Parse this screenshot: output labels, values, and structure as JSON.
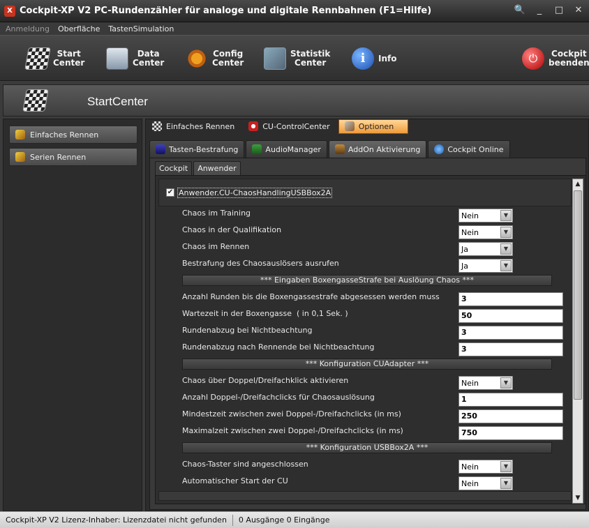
{
  "window": {
    "title": "Cockpit-XP V2 PC-Rundenzähler für analoge und digitale Rennbahnen (F1=Hilfe)",
    "app_icon_text": "X",
    "buttons": {
      "search": "🔍",
      "minimize": "_",
      "maximize": "□",
      "close": "✕"
    }
  },
  "menu": [
    "Anmeldung",
    "Oberfläche",
    "TastenSimulation"
  ],
  "toolbar": {
    "start": "Start\nCenter",
    "data": "Data\nCenter",
    "config": "Config\nCenter",
    "statistik": "Statistik\nCenter",
    "info": "Info",
    "beenden": "Cockpit\nbeenden"
  },
  "header": {
    "title": "StartCenter"
  },
  "left": {
    "items": [
      "Einfaches Rennen",
      "Serien Rennen"
    ]
  },
  "tabs1": [
    "Einfaches Rennen",
    "CU-ControlCenter",
    "Optionen"
  ],
  "tabs2": [
    "Tasten-Bestrafung",
    "AudioManager",
    "AddOn Aktivierung",
    "Cockpit Online"
  ],
  "tabs3": [
    "Cockpit",
    "Anwender"
  ],
  "addon": {
    "checked": true,
    "label": "Anwender.CU-ChaosHandlingUSBBox2A"
  },
  "settings": {
    "chaos_training": {
      "label": "Chaos im Training",
      "value": "Nein"
    },
    "chaos_quali": {
      "label": "Chaos in der Qualifikation",
      "value": "Nein"
    },
    "chaos_rennen": {
      "label": "Chaos im Rennen",
      "value": "Ja"
    },
    "bestrafung": {
      "label": "Bestrafung des Chaosauslösers ausrufen",
      "value": "Ja"
    },
    "sect_boxen": "*** Eingaben BoxengasseStrafe bei Auslöung Chaos ***",
    "anzahl_runden": {
      "label": "Anzahl Runden bis die Boxengassestrafe abgesessen werden muss",
      "value": "3"
    },
    "wartezeit": {
      "label": "Wartezeit in der Boxengasse  ( in 0,1 Sek. )",
      "value": "50"
    },
    "rundenabzug": {
      "label": "Rundenabzug bei Nichtbeachtung",
      "value": "3"
    },
    "rundenabzug_nach": {
      "label": "Rundenabzug nach Rennende bei Nichtbeachtung",
      "value": "3"
    },
    "sect_cuadapter": "*** Konfiguration CUAdapter ***",
    "doppelklick": {
      "label": "Chaos über Doppel/Dreifachklick aktivieren",
      "value": "Nein"
    },
    "anzahl_clicks": {
      "label": "Anzahl Doppel-/Dreifachclicks für Chaosauslösung",
      "value": "1"
    },
    "mindestzeit": {
      "label": "Mindestzeit zwischen zwei Doppel-/Dreifachclicks (in ms)",
      "value": "250"
    },
    "maximalzeit": {
      "label": "Maximalzeit zwischen zwei Doppel-/Dreifachclicks (in ms)",
      "value": "750"
    },
    "sect_usbbox": "*** Konfiguration USBBox2A ***",
    "taster": {
      "label": "Chaos-Taster sind angeschlossen",
      "value": "Nein"
    },
    "autostart": {
      "label": "Automatischer Start der CU",
      "value": "Nein"
    }
  },
  "status": {
    "license": "Cockpit-XP V2 Lizenz-Inhaber: Lizenzdatei nicht gefunden",
    "io": "0 Ausgänge 0 Eingänge"
  },
  "colors": {
    "accent": "#f09a3a",
    "panel": "#2c2c2c",
    "toolbar": "#3a3a3a"
  }
}
